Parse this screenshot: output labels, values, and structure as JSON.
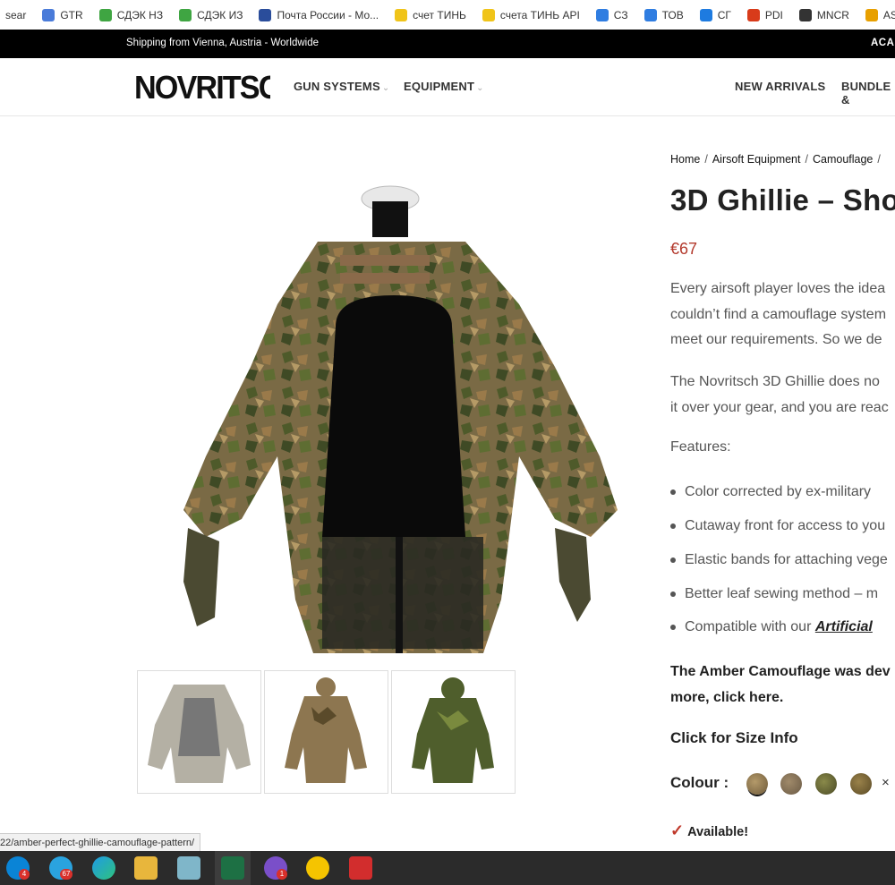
{
  "bookmarks": [
    {
      "label": "sear",
      "icon": "none",
      "color": ""
    },
    {
      "label": "GTR",
      "icon": "translate-icon",
      "color": "#4a7bd9"
    },
    {
      "label": "СДЭК НЗ",
      "icon": "cdek-icon",
      "color": "#3fa542"
    },
    {
      "label": "СДЭК ИЗ",
      "icon": "cdek-icon",
      "color": "#3fa542"
    },
    {
      "label": "Почта России - Мо...",
      "icon": "eagle-icon",
      "color": "#2a4d9b"
    },
    {
      "label": "счет ТИНЬ",
      "icon": "tinkoff-icon",
      "color": "#f0c419"
    },
    {
      "label": "счета ТИНЬ API",
      "icon": "tinkoff-icon",
      "color": "#f0c419"
    },
    {
      "label": "СЗ",
      "icon": "vk-icon",
      "color": "#2f7de1"
    },
    {
      "label": "ТОВ",
      "icon": "vk-icon",
      "color": "#2f7de1"
    },
    {
      "label": "СГ",
      "icon": "chat-icon",
      "color": "#1e7be0"
    },
    {
      "label": "PDI",
      "icon": "pdi-icon",
      "color": "#d83b1a"
    },
    {
      "label": "MNCR",
      "icon": "mncr-icon",
      "color": "#333333"
    },
    {
      "label": "ASP",
      "icon": "asp-icon",
      "color": "#e8a000"
    }
  ],
  "shipping": {
    "text": "Shipping from Vienna, Austria - Worldwide",
    "right": "ACAD"
  },
  "header": {
    "logo": "NOVRITSCH",
    "nav": {
      "gun_systems": "GUN SYSTEMS",
      "equipment": "EQUIPMENT",
      "new_arrivals": "NEW ARRIVALS",
      "bundle": "BUNDLE &"
    }
  },
  "breadcrumb": {
    "home": "Home",
    "equipment": "Airsoft Equipment",
    "camouflage": "Camouflage"
  },
  "product": {
    "title": "3D Ghillie – Sho",
    "price": "€67",
    "para1": [
      "Every airsoft player loves the idea",
      "couldn’t find a camouflage system",
      "meet our requirements. So we de"
    ],
    "para2": [
      "The Novritsch 3D Ghillie does no",
      "it over your gear, and you are reac"
    ],
    "features_head": "Features:",
    "features": [
      "Color corrected by ex-military",
      "Cutaway front for access to you",
      "Elastic bands for attaching vege",
      "Better leaf sewing method – m"
    ],
    "feature_last_prefix": "Compatible with our ",
    "feature_last_link": "Artificial",
    "amber": [
      "The Amber Camouflage was dev",
      "more, click here."
    ],
    "size_info": "Click for Size Info",
    "colour_label": "Colour :",
    "clear": "×",
    "available": "Available!"
  },
  "status_url": "22/amber-perfect-ghillie-camouflage-pattern/",
  "taskbar": {
    "badges": {
      "skype": "4",
      "telegram": "67",
      "viber": "1"
    }
  },
  "colors": {
    "accent_price": "#b3392c",
    "check": "#c0392b"
  }
}
